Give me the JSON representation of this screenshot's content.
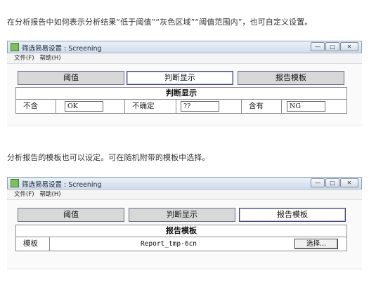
{
  "intro1": "在分析报告中如何表示分析结果“低于阈值”“灰色区域”“阈值范围内”，也可自定义设置。",
  "intro2": "分析报告的模板也可以设定。可在随机附带的模板中选择。",
  "window_title": "筛选简易设置 : Screening",
  "window_buttons": {
    "minimize": "—",
    "maximize": "□",
    "close": "✕"
  },
  "menu": {
    "file": "文件(F)",
    "help": "帮助(H)"
  },
  "tabs": {
    "threshold": "阈值",
    "judgement": "判断显示",
    "template": "报告模板"
  },
  "judgement_panel": {
    "title": "判断显示",
    "items": [
      {
        "label": "不含",
        "value": "OK"
      },
      {
        "label": "不确定",
        "value": "??"
      },
      {
        "label": "含有",
        "value": "NG"
      }
    ]
  },
  "template_panel": {
    "title": "报告模板",
    "label": "模板",
    "file": "Report_tmp-6cn",
    "select_button": "选择..."
  },
  "colors": {
    "titlebar": "#cfdceb",
    "tab_inactive": "#d8d8d8",
    "tab_active": "#ffffff",
    "border": "#6a6f8a"
  }
}
